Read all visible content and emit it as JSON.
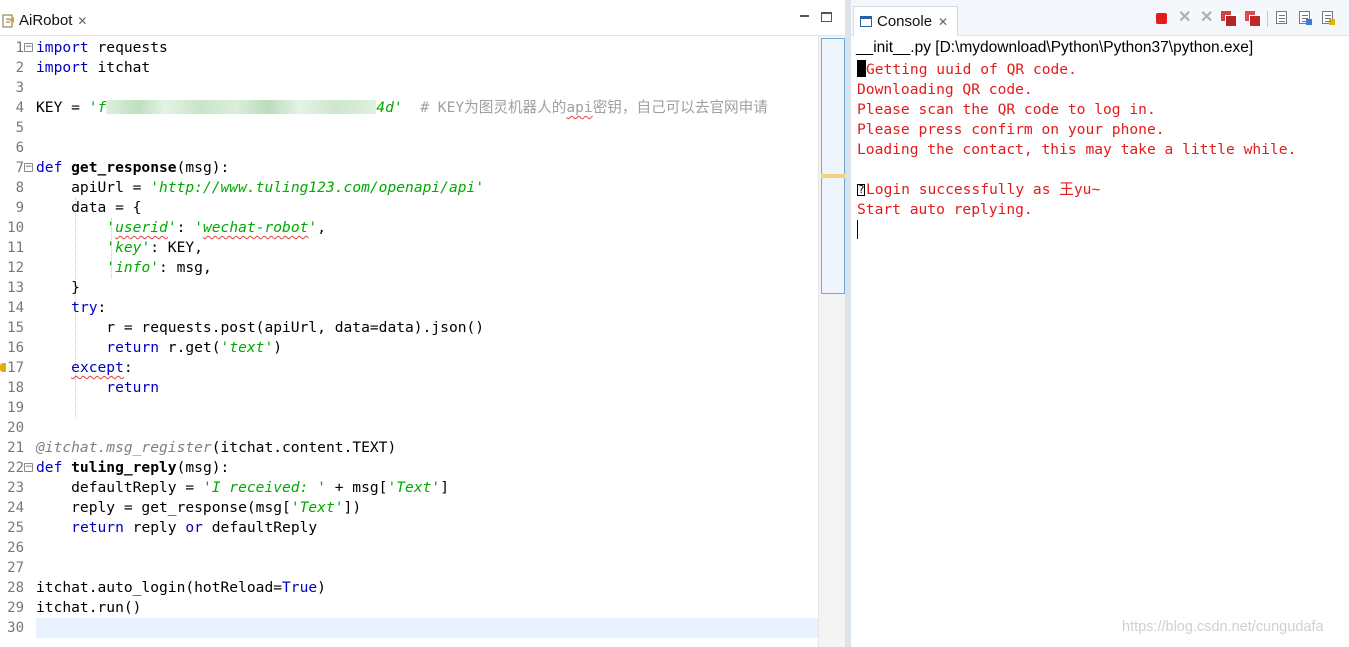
{
  "editor": {
    "tab_label": "AiRobot",
    "tab_close": "✕",
    "line_numbers": [
      "1",
      "2",
      "3",
      "4",
      "5",
      "6",
      "7",
      "8",
      "9",
      "10",
      "11",
      "12",
      "13",
      "14",
      "15",
      "16",
      "17",
      "18",
      "19",
      "20",
      "21",
      "22",
      "23",
      "24",
      "25",
      "26",
      "27",
      "28",
      "29",
      "30"
    ],
    "code": {
      "l1_kw": "import",
      "l1_rest": " requests",
      "l2_kw": "import",
      "l2_rest": " itchat",
      "l4_a": "KEY = ",
      "l4_str_open": "'f",
      "l4_str_close": "4d'",
      "l4_cmt": "  # KEY为图灵机器人的",
      "l4_cmt_api": "api",
      "l4_cmt_rest": "密钥，自己可以去官网申请",
      "l7_kw": "def",
      "l7_fn": " get_response",
      "l7_rest": "(msg):",
      "l8_a": "    apiUrl = ",
      "l8_str": "'http://www.tuling123.com/openapi/api'",
      "l9": "    data = {",
      "l10_pad": "        ",
      "l10_q1": "'",
      "l10_k": "userid",
      "l10_q2": "'",
      "l10_colon": ": ",
      "l10_q3": "'",
      "l10_v": "wechat-robot",
      "l10_q4": "'",
      "l10_end": ",",
      "l11_pad": "        ",
      "l11_str": "'key'",
      "l11_rest": ": KEY,",
      "l12_pad": "        ",
      "l12_str": "'info'",
      "l12_rest": ": msg,",
      "l13": "    }",
      "l14_pad": "    ",
      "l14_kw": "try",
      "l14_rest": ":",
      "l15": "        r = requests.post(apiUrl, data=data).json()",
      "l16_pad": "        ",
      "l16_kw": "return",
      "l16_a": " r.get(",
      "l16_str": "'text'",
      "l16_b": ")",
      "l17_pad": "    ",
      "l17_kw": "except",
      "l17_rest": ":",
      "l18_pad": "        ",
      "l18_kw": "return",
      "l21_deco": "@itchat.msg_register",
      "l21_rest": "(itchat.content.TEXT)",
      "l22_kw": "def",
      "l22_fn": " tuling_reply",
      "l22_rest": "(msg):",
      "l23_a": "    defaultReply = ",
      "l23_str": "'I received: '",
      "l23_b": " + msg[",
      "l23_str2": "'Text'",
      "l23_c": "]",
      "l24_a": "    reply = get_response(msg[",
      "l24_str": "'Text'",
      "l24_b": "])",
      "l25_pad": "    ",
      "l25_kw": "return",
      "l25_a": " reply ",
      "l25_kw2": "or",
      "l25_b": " defaultReply",
      "l28_a": "itchat.auto_login(hotReload=",
      "l28_true": "True",
      "l28_b": ")",
      "l29": "itchat.run()"
    }
  },
  "console": {
    "tab_label": "Console",
    "tab_close": "✕",
    "process": "__init__.py [D:\\mydownload\\Python\\Python37\\python.exe]",
    "lines": [
      "Getting uuid of QR code.",
      "Downloading QR code.",
      "Please scan the QR code to log in.",
      "Please press confirm on your phone.",
      "Loading the contact, this may take a little while.",
      "",
      "Login successfully as 王yu~",
      "Start auto replying."
    ],
    "qmark_glyph": "?",
    "watermark": "https://blog.csdn.net/cungudafa"
  },
  "colors": {
    "keyword": "#0000c0",
    "string": "#00aa00",
    "comment": "#a0a0a0",
    "console_text": "#e21b1b",
    "current_line": "#e8f2fe"
  }
}
